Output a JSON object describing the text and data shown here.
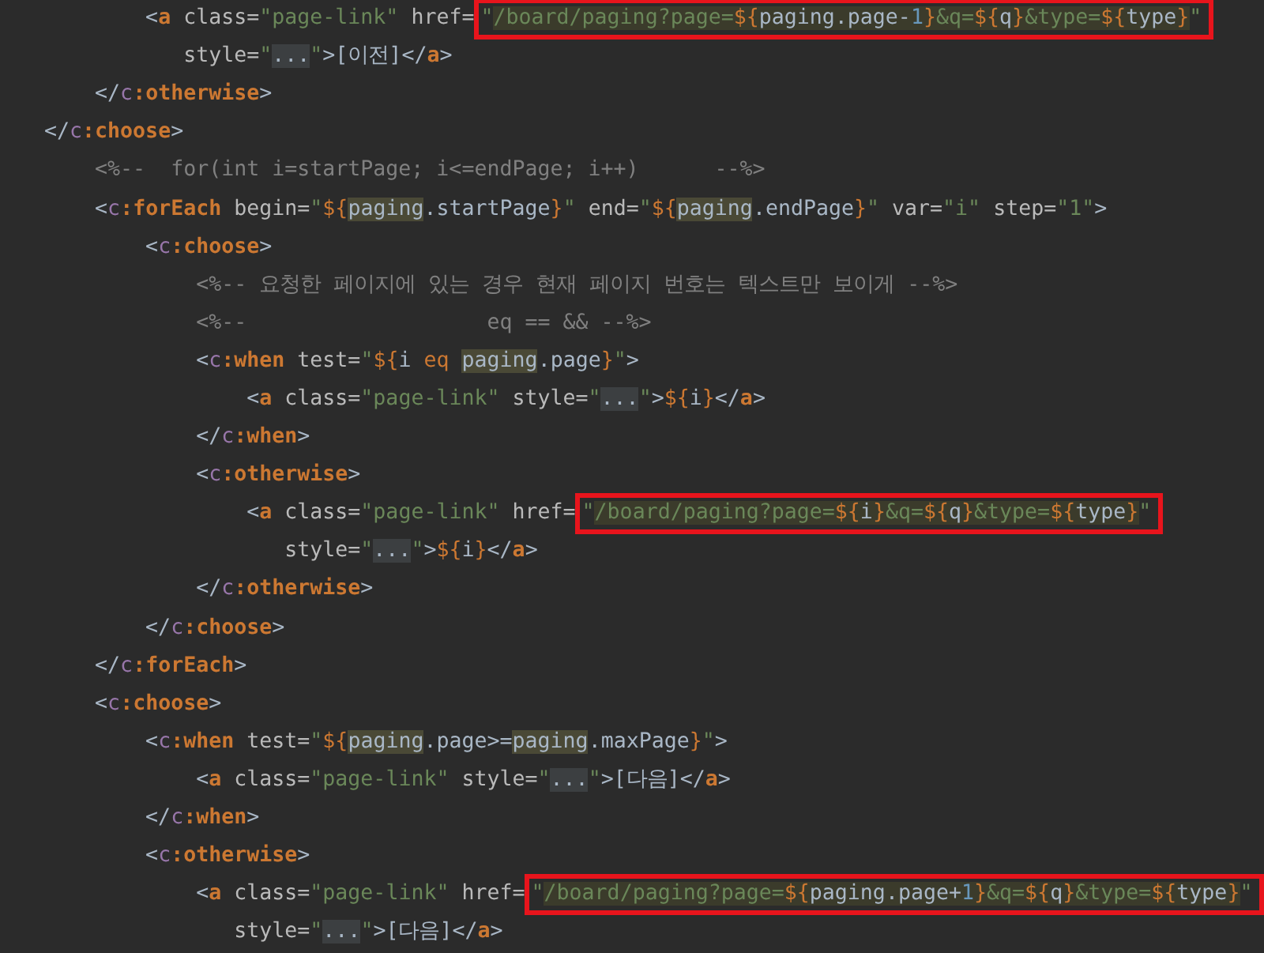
{
  "editor": {
    "lines": [
      {
        "parts": [
          {
            "t": "        <",
            "kind": "plain"
          },
          {
            "t": "a",
            "kind": "tag"
          },
          {
            "t": " class=",
            "kind": "attr"
          },
          {
            "t": "\"page-link\"",
            "kind": "string"
          },
          {
            "t": " href=",
            "kind": "attr"
          }
        ],
        "boxed": [
          {
            "t": "\"",
            "kind": "string"
          },
          {
            "t": "/board/paging?page=",
            "kind": "string",
            "injected": true
          },
          {
            "t": "${",
            "kind": "expr",
            "injected": true
          },
          {
            "t": "paging.page-",
            "kind": "plain",
            "injected": true
          },
          {
            "t": "1",
            "kind": "number",
            "injected": true
          },
          {
            "t": "}",
            "kind": "expr",
            "injected": true
          },
          {
            "t": "&q=",
            "kind": "string",
            "injected": true
          },
          {
            "t": "${",
            "kind": "expr",
            "injected": true
          },
          {
            "t": "q",
            "kind": "plain",
            "injected": true
          },
          {
            "t": "}",
            "kind": "expr",
            "injected": true
          },
          {
            "t": "&type=",
            "kind": "string",
            "injected": true
          },
          {
            "t": "${",
            "kind": "expr",
            "injected": true
          },
          {
            "t": "type",
            "kind": "plain",
            "injected": true
          },
          {
            "t": "}",
            "kind": "expr",
            "injected": true
          },
          {
            "t": "\"",
            "kind": "string"
          }
        ]
      },
      {
        "parts": [
          {
            "t": "           style=",
            "kind": "attr"
          },
          {
            "t": "\"",
            "kind": "string"
          },
          {
            "t": "...",
            "kind": "plain",
            "folded": true
          },
          {
            "t": "\"",
            "kind": "string"
          },
          {
            "t": ">[이전]",
            "kind": "plain"
          },
          {
            "t": "</",
            "kind": "plain"
          },
          {
            "t": "a",
            "kind": "tag"
          },
          {
            "t": ">",
            "kind": "plain"
          }
        ]
      },
      {
        "parts": [
          {
            "t": "    </",
            "kind": "plain"
          },
          {
            "t": "c",
            "kind": "namespace"
          },
          {
            "t": ":otherwise",
            "kind": "tag"
          },
          {
            "t": ">",
            "kind": "plain"
          }
        ]
      },
      {
        "parts": [
          {
            "t": "</",
            "kind": "plain"
          },
          {
            "t": "c",
            "kind": "namespace"
          },
          {
            "t": ":choose",
            "kind": "tag"
          },
          {
            "t": ">",
            "kind": "plain"
          }
        ]
      },
      {
        "parts": [
          {
            "t": "    <%--  for(int i=startPage; i<=endPage; i++)      --%>",
            "kind": "comment"
          }
        ]
      },
      {
        "parts": [
          {
            "t": "    <",
            "kind": "plain"
          },
          {
            "t": "c",
            "kind": "namespace"
          },
          {
            "t": ":forEach",
            "kind": "tag"
          },
          {
            "t": " begin=",
            "kind": "attr"
          },
          {
            "t": "\"",
            "kind": "string"
          },
          {
            "t": "${",
            "kind": "expr"
          },
          {
            "t": "paging",
            "kind": "plain",
            "match": true
          },
          {
            "t": ".startPage",
            "kind": "plain"
          },
          {
            "t": "}",
            "kind": "expr"
          },
          {
            "t": "\"",
            "kind": "string"
          },
          {
            "t": " end=",
            "kind": "attr"
          },
          {
            "t": "\"",
            "kind": "string"
          },
          {
            "t": "${",
            "kind": "expr"
          },
          {
            "t": "paging",
            "kind": "plain",
            "match": true
          },
          {
            "t": ".endPage",
            "kind": "plain"
          },
          {
            "t": "}",
            "kind": "expr"
          },
          {
            "t": "\"",
            "kind": "string"
          },
          {
            "t": " var=",
            "kind": "attr"
          },
          {
            "t": "\"i\"",
            "kind": "string"
          },
          {
            "t": " step=",
            "kind": "attr"
          },
          {
            "t": "\"1\"",
            "kind": "string"
          },
          {
            "t": ">",
            "kind": "plain"
          }
        ]
      },
      {
        "parts": [
          {
            "t": "        <",
            "kind": "plain"
          },
          {
            "t": "c",
            "kind": "namespace"
          },
          {
            "t": ":choose",
            "kind": "tag"
          },
          {
            "t": ">",
            "kind": "plain"
          }
        ]
      },
      {
        "parts": [
          {
            "t": "            <%-- 요청한 페이지에 있는 경우 현재 페이지 번호는 텍스트만 보이게 --%>",
            "kind": "comment"
          }
        ]
      },
      {
        "parts": [
          {
            "t": "            <%--                   eq == && --%>",
            "kind": "comment"
          }
        ]
      },
      {
        "parts": [
          {
            "t": "            <",
            "kind": "plain"
          },
          {
            "t": "c",
            "kind": "namespace"
          },
          {
            "t": ":when",
            "kind": "tag"
          },
          {
            "t": " test=",
            "kind": "attr"
          },
          {
            "t": "\"",
            "kind": "string"
          },
          {
            "t": "${",
            "kind": "expr"
          },
          {
            "t": "i ",
            "kind": "plain"
          },
          {
            "t": "eq ",
            "kind": "keyword"
          },
          {
            "t": "paging",
            "kind": "plain",
            "match": true
          },
          {
            "t": ".page",
            "kind": "plain"
          },
          {
            "t": "}",
            "kind": "expr"
          },
          {
            "t": "\"",
            "kind": "string"
          },
          {
            "t": ">",
            "kind": "plain"
          }
        ]
      },
      {
        "parts": [
          {
            "t": "                <",
            "kind": "plain"
          },
          {
            "t": "a",
            "kind": "tag"
          },
          {
            "t": " class=",
            "kind": "attr"
          },
          {
            "t": "\"page-link\"",
            "kind": "string"
          },
          {
            "t": " style=",
            "kind": "attr"
          },
          {
            "t": "\"",
            "kind": "string"
          },
          {
            "t": "...",
            "kind": "plain",
            "folded": true
          },
          {
            "t": "\"",
            "kind": "string"
          },
          {
            "t": ">",
            "kind": "plain"
          },
          {
            "t": "${",
            "kind": "expr"
          },
          {
            "t": "i",
            "kind": "plain"
          },
          {
            "t": "}",
            "kind": "expr"
          },
          {
            "t": "</",
            "kind": "plain"
          },
          {
            "t": "a",
            "kind": "tag"
          },
          {
            "t": ">",
            "kind": "plain"
          }
        ]
      },
      {
        "parts": [
          {
            "t": "            </",
            "kind": "plain"
          },
          {
            "t": "c",
            "kind": "namespace"
          },
          {
            "t": ":when",
            "kind": "tag"
          },
          {
            "t": ">",
            "kind": "plain"
          }
        ]
      },
      {
        "parts": [
          {
            "t": "            <",
            "kind": "plain"
          },
          {
            "t": "c",
            "kind": "namespace"
          },
          {
            "t": ":otherwise",
            "kind": "tag"
          },
          {
            "t": ">",
            "kind": "plain"
          }
        ]
      },
      {
        "parts": [
          {
            "t": "                <",
            "kind": "plain"
          },
          {
            "t": "a",
            "kind": "tag"
          },
          {
            "t": " class=",
            "kind": "attr"
          },
          {
            "t": "\"page-link\"",
            "kind": "string"
          },
          {
            "t": " href=",
            "kind": "attr"
          }
        ],
        "boxed": [
          {
            "t": "\"",
            "kind": "string"
          },
          {
            "t": "/board/paging?page=",
            "kind": "string",
            "injected": true
          },
          {
            "t": "${",
            "kind": "expr",
            "injected": true
          },
          {
            "t": "i",
            "kind": "plain",
            "injected": true
          },
          {
            "t": "}",
            "kind": "expr",
            "injected": true
          },
          {
            "t": "&q=",
            "kind": "string",
            "injected": true
          },
          {
            "t": "${",
            "kind": "expr",
            "injected": true
          },
          {
            "t": "q",
            "kind": "plain",
            "injected": true
          },
          {
            "t": "}",
            "kind": "expr",
            "injected": true
          },
          {
            "t": "&type=",
            "kind": "string",
            "injected": true
          },
          {
            "t": "${",
            "kind": "expr",
            "injected": true
          },
          {
            "t": "type",
            "kind": "plain",
            "injected": true
          },
          {
            "t": "}",
            "kind": "expr",
            "injected": true
          },
          {
            "t": "\"",
            "kind": "string"
          }
        ]
      },
      {
        "parts": [
          {
            "t": "                   style=",
            "kind": "attr"
          },
          {
            "t": "\"",
            "kind": "string"
          },
          {
            "t": "...",
            "kind": "plain",
            "folded": true
          },
          {
            "t": "\"",
            "kind": "string"
          },
          {
            "t": ">",
            "kind": "plain"
          },
          {
            "t": "${",
            "kind": "expr"
          },
          {
            "t": "i",
            "kind": "plain"
          },
          {
            "t": "}",
            "kind": "expr"
          },
          {
            "t": "</",
            "kind": "plain"
          },
          {
            "t": "a",
            "kind": "tag"
          },
          {
            "t": ">",
            "kind": "plain"
          }
        ]
      },
      {
        "parts": [
          {
            "t": "            </",
            "kind": "plain"
          },
          {
            "t": "c",
            "kind": "namespace"
          },
          {
            "t": ":otherwise",
            "kind": "tag"
          },
          {
            "t": ">",
            "kind": "plain"
          }
        ]
      },
      {
        "parts": [
          {
            "t": "        </",
            "kind": "plain"
          },
          {
            "t": "c",
            "kind": "namespace"
          },
          {
            "t": ":choose",
            "kind": "tag"
          },
          {
            "t": ">",
            "kind": "plain"
          }
        ]
      },
      {
        "parts": [
          {
            "t": "    </",
            "kind": "plain"
          },
          {
            "t": "c",
            "kind": "namespace"
          },
          {
            "t": ":forEach",
            "kind": "tag"
          },
          {
            "t": ">",
            "kind": "plain"
          }
        ]
      },
      {
        "parts": [
          {
            "t": "    <",
            "kind": "plain"
          },
          {
            "t": "c",
            "kind": "namespace"
          },
          {
            "t": ":choose",
            "kind": "tag"
          },
          {
            "t": ">",
            "kind": "plain"
          }
        ]
      },
      {
        "parts": [
          {
            "t": "        <",
            "kind": "plain"
          },
          {
            "t": "c",
            "kind": "namespace"
          },
          {
            "t": ":when",
            "kind": "tag"
          },
          {
            "t": " test=",
            "kind": "attr"
          },
          {
            "t": "\"",
            "kind": "string"
          },
          {
            "t": "${",
            "kind": "expr"
          },
          {
            "t": "paging",
            "kind": "plain",
            "match": true
          },
          {
            "t": ".page>=",
            "kind": "plain"
          },
          {
            "t": "paging",
            "kind": "plain",
            "match": true
          },
          {
            "t": ".maxPage",
            "kind": "plain"
          },
          {
            "t": "}",
            "kind": "expr"
          },
          {
            "t": "\"",
            "kind": "string"
          },
          {
            "t": ">",
            "kind": "plain"
          }
        ]
      },
      {
        "parts": [
          {
            "t": "            <",
            "kind": "plain"
          },
          {
            "t": "a",
            "kind": "tag"
          },
          {
            "t": " class=",
            "kind": "attr"
          },
          {
            "t": "\"page-link\"",
            "kind": "string"
          },
          {
            "t": " style=",
            "kind": "attr"
          },
          {
            "t": "\"",
            "kind": "string"
          },
          {
            "t": "...",
            "kind": "plain",
            "folded": true
          },
          {
            "t": "\"",
            "kind": "string"
          },
          {
            "t": ">[다음]",
            "kind": "plain"
          },
          {
            "t": "</",
            "kind": "plain"
          },
          {
            "t": "a",
            "kind": "tag"
          },
          {
            "t": ">",
            "kind": "plain"
          }
        ]
      },
      {
        "parts": [
          {
            "t": "        </",
            "kind": "plain"
          },
          {
            "t": "c",
            "kind": "namespace"
          },
          {
            "t": ":when",
            "kind": "tag"
          },
          {
            "t": ">",
            "kind": "plain"
          }
        ]
      },
      {
        "parts": [
          {
            "t": "        <",
            "kind": "plain"
          },
          {
            "t": "c",
            "kind": "namespace"
          },
          {
            "t": ":otherwise",
            "kind": "tag"
          },
          {
            "t": ">",
            "kind": "plain"
          }
        ]
      },
      {
        "parts": [
          {
            "t": "            <",
            "kind": "plain"
          },
          {
            "t": "a",
            "kind": "tag"
          },
          {
            "t": " class=",
            "kind": "attr"
          },
          {
            "t": "\"page-link\"",
            "kind": "string"
          },
          {
            "t": " href=",
            "kind": "attr"
          }
        ],
        "boxed": [
          {
            "t": "\"",
            "kind": "string"
          },
          {
            "t": "/board/paging?page=",
            "kind": "string",
            "injected": true
          },
          {
            "t": "${",
            "kind": "expr",
            "injected": true
          },
          {
            "t": "paging.page+",
            "kind": "plain",
            "injected": true
          },
          {
            "t": "1",
            "kind": "number",
            "injected": true
          },
          {
            "t": "}",
            "kind": "expr",
            "injected": true
          },
          {
            "t": "&q=",
            "kind": "string",
            "injected": true
          },
          {
            "t": "${",
            "kind": "expr",
            "injected": true
          },
          {
            "t": "q",
            "kind": "plain",
            "injected": true
          },
          {
            "t": "}",
            "kind": "expr",
            "injected": true
          },
          {
            "t": "&type=",
            "kind": "string",
            "injected": true
          },
          {
            "t": "${",
            "kind": "expr",
            "injected": true
          },
          {
            "t": "type",
            "kind": "plain",
            "injected": true
          },
          {
            "t": "}",
            "kind": "expr",
            "injected": true
          },
          {
            "t": "\"",
            "kind": "string"
          }
        ]
      },
      {
        "parts": [
          {
            "t": "               style=",
            "kind": "attr"
          },
          {
            "t": "\"",
            "kind": "string"
          },
          {
            "t": "...",
            "kind": "plain",
            "folded": true
          },
          {
            "t": "\"",
            "kind": "string"
          },
          {
            "t": ">[다음]",
            "kind": "plain"
          },
          {
            "t": "</",
            "kind": "plain"
          },
          {
            "t": "a",
            "kind": "tag"
          },
          {
            "t": ">",
            "kind": "plain"
          }
        ]
      }
    ]
  }
}
